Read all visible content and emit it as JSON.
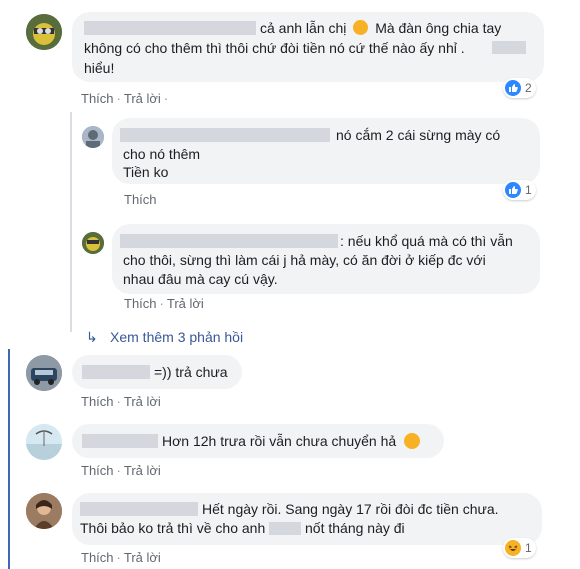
{
  "comments": [
    {
      "text_line1": "cả anh lẫn chị",
      "text_line2": "Mà đàn ông chia tay không có cho thêm thì thôi chứ đòi tiền nó cứ thế nào ấy nhỉ .",
      "text_line3": "hiểu!",
      "like": "Thích",
      "reply": "Trả lời",
      "reactions": "2"
    }
  ],
  "replies": [
    {
      "text_line1": "nó cắm 2 cái sừng mày có",
      "text_line2": "cho nó thêm",
      "text_line3": "Tiền ko",
      "like": "Thích",
      "reactions": "1"
    },
    {
      "text_line1": ": nếu khổ quá mà có thì vẫn",
      "text_line2": "cho thôi, sừng thì làm cái j hả mày, có ăn đời ở kiếp đc với",
      "text_line3": "nhau đâu mà cay cú vậy.",
      "like": "Thích",
      "reply": "Trả lời"
    }
  ],
  "more_replies": "Xem thêm 3 phản hồi",
  "c2": {
    "text": "=)) trả chưa",
    "like": "Thích",
    "reply": "Trả lời"
  },
  "c3": {
    "text": "Hơn 12h trưa rồi vẫn chưa chuyển hả",
    "like": "Thích",
    "reply": "Trả lời"
  },
  "c4": {
    "text_line1": "Hết ngày rồi. Sang ngày 17 rồi đòi đc tiền chưa.",
    "text_line2a": "Thôi bảo ko trả thì về cho anh",
    "text_line2b": "nốt tháng này đi",
    "like": "Thích",
    "reply": "Trả lời",
    "reactions": "1"
  },
  "colors": {
    "accent": "#385898",
    "like_blue": "#2d88ff",
    "bubble": "#f2f3f5"
  }
}
